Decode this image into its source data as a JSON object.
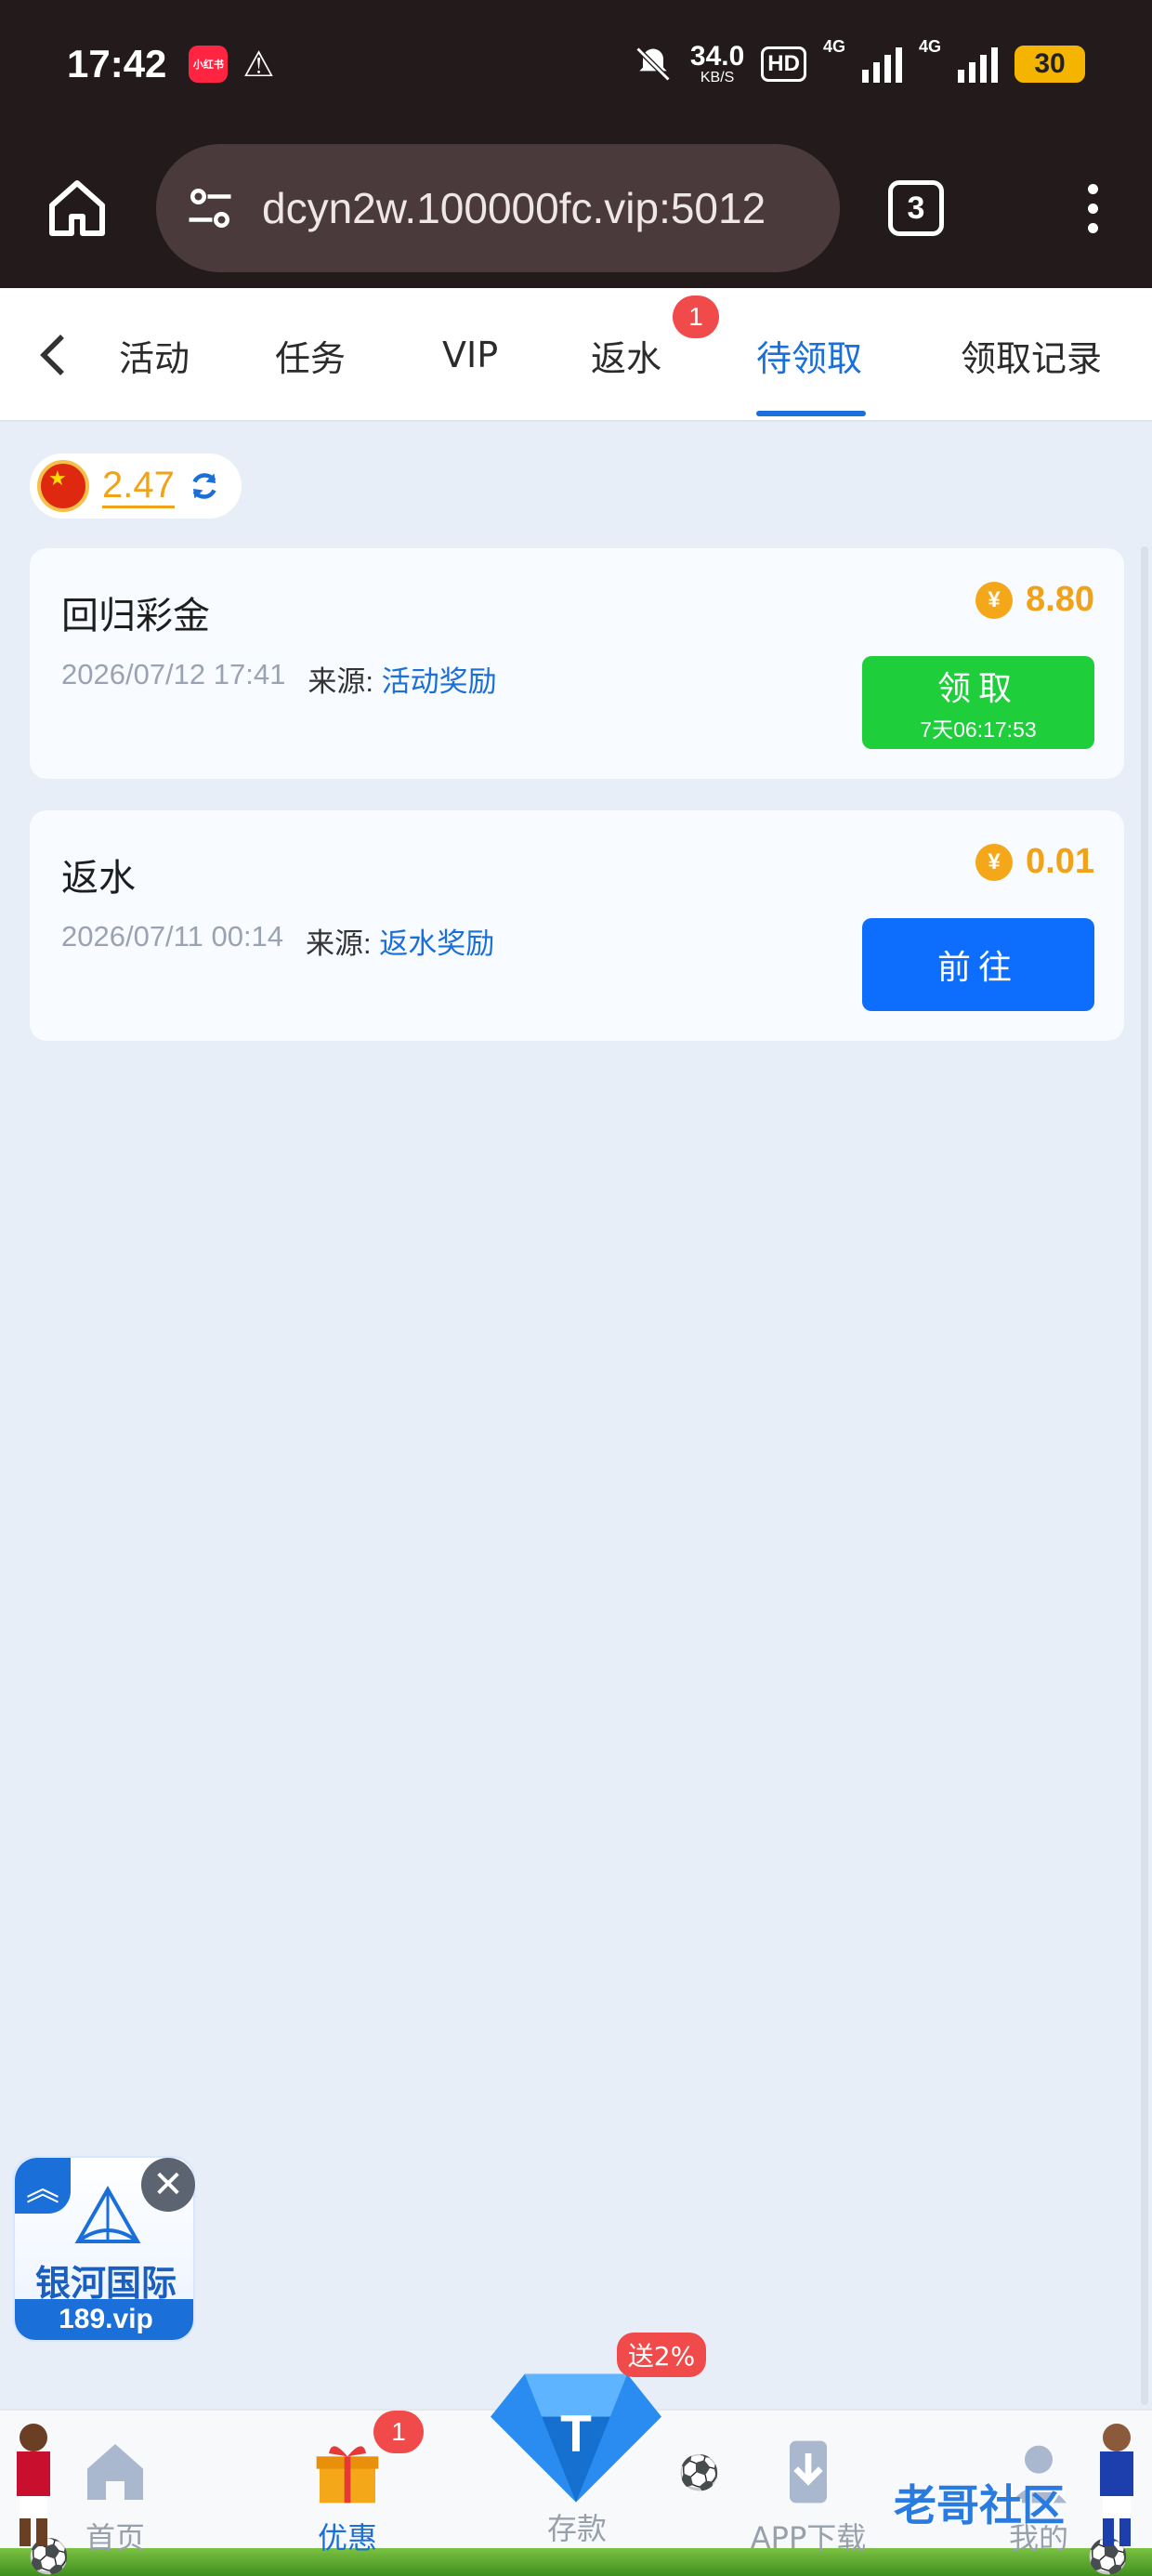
{
  "status_bar": {
    "time": "17:42",
    "app_badge": "小红书",
    "speed_value": "34.0",
    "speed_unit": "KB/S",
    "hd": "HD",
    "network1": "4G",
    "network2": "4G",
    "battery": "30"
  },
  "browser": {
    "url": "dcyn2w.100000fc.vip:5012",
    "tab_count": "3"
  },
  "tabs": [
    {
      "label": "活动",
      "active": false
    },
    {
      "label": "任务",
      "active": false
    },
    {
      "label": "VIP",
      "active": false
    },
    {
      "label": "返水",
      "active": false,
      "badge": "1"
    },
    {
      "label": "待领取",
      "active": true
    },
    {
      "label": "领取记录",
      "active": false
    }
  ],
  "balance": {
    "amount": "2.47"
  },
  "rewards": [
    {
      "title": "回归彩金",
      "date": "2026/07/12 17:41",
      "source_label": "来源:",
      "source": "活动奖励",
      "amount": "8.80",
      "coin_symbol": "¥",
      "button_label": "领取",
      "button_countdown": "7天06:17:53",
      "button_color": "#1fce3b"
    },
    {
      "title": "返水",
      "date": "2026/07/11 00:14",
      "source_label": "来源:",
      "source": "返水奖励",
      "amount": "0.01",
      "coin_symbol": "¥",
      "button_label": "前往",
      "button_color": "#0d6efd"
    }
  ],
  "promo": {
    "name": "银河国际",
    "url": "189.vip"
  },
  "bottom_nav": [
    {
      "label": "首页",
      "active": false
    },
    {
      "label": "优惠",
      "active": true,
      "badge": "1"
    },
    {
      "label": "存款",
      "active": false,
      "gift": "送2%"
    },
    {
      "label": "APP下载",
      "active": false
    },
    {
      "label": "我的",
      "active": false
    }
  ],
  "watermark": "老哥社区",
  "colors": {
    "accent": "#1a6fd8",
    "amount": "#f0a21a",
    "badge": "#f04a4a"
  }
}
